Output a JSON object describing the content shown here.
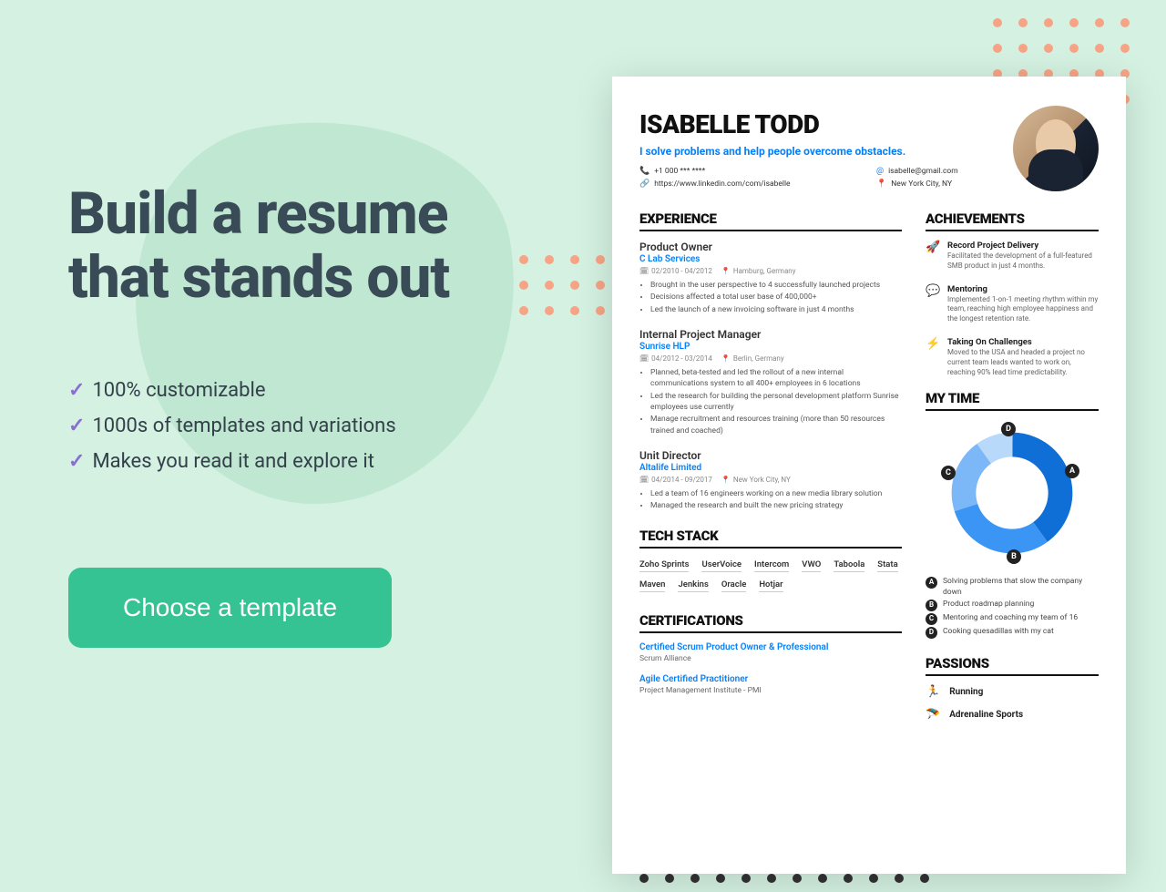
{
  "headline_l1": "Build a resume",
  "headline_l2": "that stands out",
  "features": [
    "100% customizable",
    "1000s of templates and variations",
    "Makes you read it and explore it"
  ],
  "cta_label": "Choose a template",
  "resume": {
    "name": "ISABELLE TODD",
    "tagline": "I solve problems and help people overcome obstacles.",
    "contact": {
      "phone": "+1 000 *** ****",
      "email": "isabelle@gmail.com",
      "linkedin": "https://www.linkedin.com/com/isabelle",
      "location": "New York City, NY"
    },
    "sections": {
      "experience": "EXPERIENCE",
      "tech": "TECH STACK",
      "certs": "CERTIFICATIONS",
      "ach": "ACHIEVEMENTS",
      "time": "MY TIME",
      "passions": "PASSIONS"
    },
    "experience": [
      {
        "title": "Product Owner",
        "company": "C Lab Services",
        "dates": "02/2010 - 04/2012",
        "location": "Hamburg, Germany",
        "bullets": [
          "Brought in the user perspective to 4 successfully launched projects",
          "Decisions affected a total user base of 400,000+",
          "Led the launch of a new invoicing software in just 4 months"
        ]
      },
      {
        "title": "Internal Project Manager",
        "company": "Sunrise HLP",
        "dates": "04/2012 - 03/2014",
        "location": "Berlin, Germany",
        "bullets": [
          "Planned, beta-tested and led the rollout of a new internal communications system to all 400+ employees in 6 locations",
          "Led the research for building the personal development platform Sunrise employees use currently",
          "Manage recruitment and resources training (more than 50 resources trained and coached)"
        ]
      },
      {
        "title": "Unit Director",
        "company": "Altalife Limited",
        "dates": "04/2014 - 09/2017",
        "location": "New York City, NY",
        "bullets": [
          "Led a team of 16 engineers working on a new media library solution",
          "Managed the research and built the new pricing strategy"
        ]
      }
    ],
    "tech": [
      "Zoho Sprints",
      "UserVoice",
      "Intercom",
      "VWO",
      "Taboola",
      "Stata",
      "Maven",
      "Jenkins",
      "Oracle",
      "Hotjar"
    ],
    "certs": [
      {
        "title": "Certified Scrum Product Owner & Professional",
        "org": "Scrum Alliance"
      },
      {
        "title": "Agile Certified Practitioner",
        "org": "Project Management Institute - PMI"
      }
    ],
    "achievements": [
      {
        "icon": "🚀",
        "title": "Record Project Delivery",
        "desc": "Facilitated the development of a full-featured SMB product in just 4 months."
      },
      {
        "icon": "💬",
        "title": "Mentoring",
        "desc": "Implemented 1-on-1 meeting rhythm within my team, reaching high employee happiness and the longest retention rate."
      },
      {
        "icon": "⚡",
        "title": "Taking On Challenges",
        "desc": "Moved to the USA and headed a project no current team leads wanted to work on, reaching 90% lead time predictability."
      }
    ],
    "time_legend": [
      {
        "l": "A",
        "t": "Solving problems that slow the company down"
      },
      {
        "l": "B",
        "t": "Product roadmap planning"
      },
      {
        "l": "C",
        "t": "Mentoring and coaching my team of 16"
      },
      {
        "l": "D",
        "t": "Cooking quesadillas with my cat"
      }
    ],
    "passions": [
      {
        "icon": "🏃",
        "title": "Running"
      },
      {
        "icon": "🪂",
        "title": "Adrenaline Sports"
      }
    ]
  },
  "colors": {
    "accent": "#0780f7",
    "cta": "#36c394",
    "headline": "#384b56"
  },
  "chart_data": {
    "type": "pie",
    "title": "MY TIME",
    "series": [
      {
        "name": "A",
        "label": "Solving problems that slow the company down",
        "value": 40
      },
      {
        "name": "B",
        "label": "Product roadmap planning",
        "value": 30
      },
      {
        "name": "C",
        "label": "Mentoring and coaching my team of 16",
        "value": 20
      },
      {
        "name": "D",
        "label": "Cooking quesadillas with my cat",
        "value": 10
      }
    ]
  }
}
